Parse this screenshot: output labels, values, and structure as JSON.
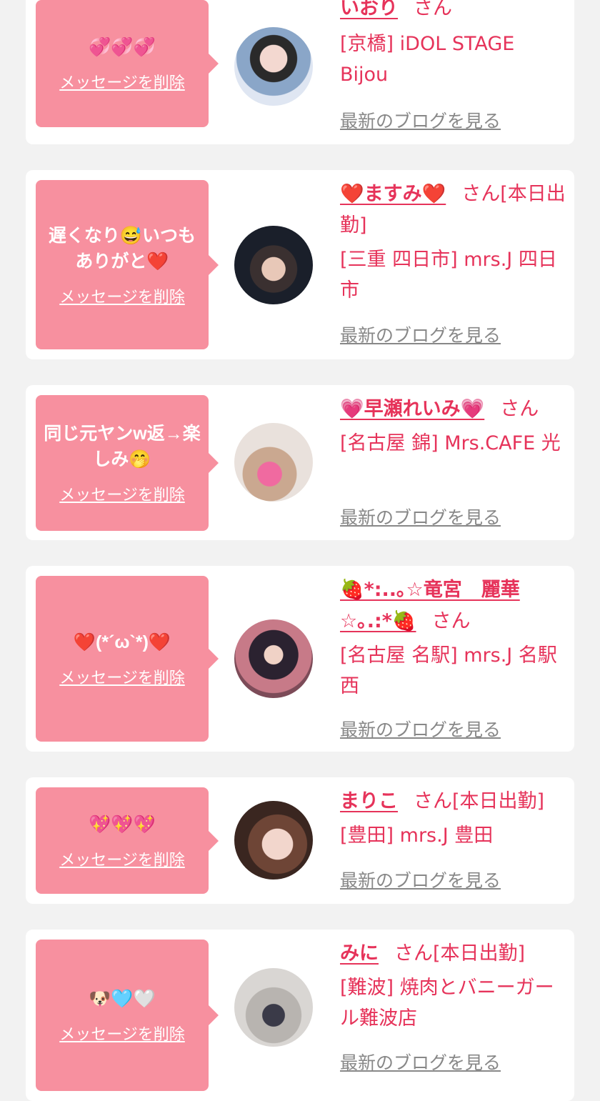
{
  "cards": [
    {
      "message": "💞💞💞",
      "delete_label": "メッセージを削除",
      "name": "いおり",
      "san": "さん",
      "shop": "[京橋] iDOL STAGE Bijou",
      "blog_label": "最新のブログを見る"
    },
    {
      "message": "遅くなり😅いつもありがと❤️",
      "delete_label": "メッセージを削除",
      "name": "❤️ますみ❤️",
      "san": "さん[本日出勤]",
      "shop": "[三重 四日市] mrs.J 四日市",
      "blog_label": "最新のブログを見る"
    },
    {
      "message": "同じ元ヤンw返→楽しみ🤭",
      "delete_label": "メッセージを削除",
      "name": "💗早瀬れいみ💗",
      "san": "さん",
      "shop": "[名古屋 錦] Mrs.CAFE 光",
      "blog_label": "最新のブログを見る"
    },
    {
      "message": "❤️(*´ω`*)❤️",
      "delete_label": "メッセージを削除",
      "name": "🍓*:..｡☆竜宮　麗華☆｡.:*🍓",
      "san": "さん",
      "shop": "[名古屋 名駅] mrs.J 名駅西",
      "blog_label": "最新のブログを見る"
    },
    {
      "message": "💖💖💖",
      "delete_label": "メッセージを削除",
      "name": "まりこ",
      "san": "さん[本日出勤]",
      "shop": "[豊田] mrs.J 豊田",
      "blog_label": "最新のブログを見る"
    },
    {
      "message": "🐶🩵🤍",
      "delete_label": "メッセージを削除",
      "name": "みに",
      "san": "さん[本日出勤]",
      "shop": "[難波] 焼肉とバニーガール難波店",
      "blog_label": "最新のブログを見る"
    }
  ],
  "colors": {
    "background": "#f2f2f2",
    "bubble": "#f7909f",
    "accent": "#e6335a",
    "link_gray": "#888888"
  }
}
